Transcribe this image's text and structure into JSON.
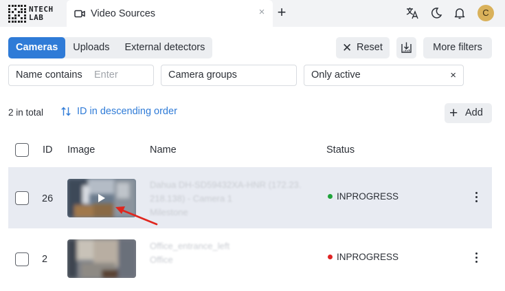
{
  "logo": {
    "line1": "NTECH",
    "line2": "LAB"
  },
  "tab": {
    "title": "Video Sources",
    "close": "×",
    "new_tab": "+"
  },
  "header_icons": [
    "translate-icon",
    "moon-icon",
    "bell-icon"
  ],
  "user": {
    "initial": "C",
    "color": "#d9b15a"
  },
  "source_tabs": [
    {
      "label": "Cameras",
      "active": true
    },
    {
      "label": "Uploads",
      "active": false
    },
    {
      "label": "External detectors",
      "active": false
    }
  ],
  "toolbar": {
    "reset": "Reset",
    "more_filters": "More filters",
    "add": "Add"
  },
  "filters": {
    "name_label": "Name contains",
    "name_placeholder": "Enter",
    "groups_label": "Camera groups",
    "active_label": "Only active",
    "clear": "×"
  },
  "summary": {
    "total": "2 in total",
    "sort": "ID in descending order"
  },
  "table": {
    "headers": {
      "id": "ID",
      "image": "Image",
      "name": "Name",
      "status": "Status"
    },
    "rows": [
      {
        "id": "26",
        "name_lines": [
          "Dahua DH-SD59432XA-HNR (172.23.",
          "218.138) - Camera 1",
          "Milestone"
        ],
        "status": "INPROGRESS",
        "status_color": "#1fa33a",
        "highlighted": true
      },
      {
        "id": "2",
        "name_lines": [
          "Office_entrance_left",
          "Office"
        ],
        "status": "INPROGRESS",
        "status_color": "#e02424",
        "highlighted": false
      }
    ]
  },
  "colors": {
    "accent": "#2f7bd7",
    "row_highlight": "#e8ebf2",
    "annotation_arrow": "#e0261e"
  }
}
